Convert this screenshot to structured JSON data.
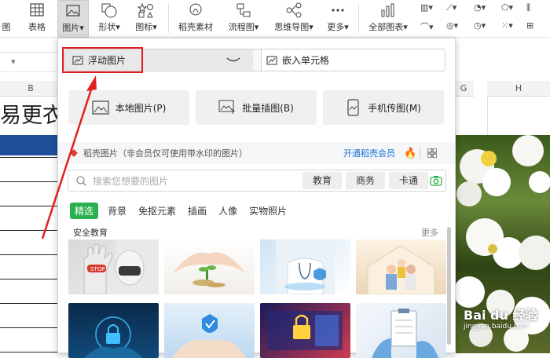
{
  "ribbon": {
    "items": [
      {
        "label": "图"
      },
      {
        "label": "表格"
      },
      {
        "label": "图片▾"
      },
      {
        "label": "形状▾"
      },
      {
        "label": "图标▾"
      },
      {
        "label": "稻壳素材"
      },
      {
        "label": "流程图▾"
      },
      {
        "label": "思维导图▾"
      },
      {
        "label": "更多▾"
      },
      {
        "label": "全部图表▾"
      }
    ]
  },
  "sheet": {
    "col_b": "B",
    "col_g": "G",
    "col_h": "H",
    "title_text": "易更衣室"
  },
  "panel": {
    "float_label": "浮动图片",
    "embed_label": "嵌入单元格",
    "local_btn": "本地图片(P)",
    "batch_btn": "批量插图(B)",
    "phone_btn": "手机传图(M)",
    "section_title": "稻壳图片（非会员仅可使用带水印的图片）",
    "member_link": "开通稻壳会员",
    "search_placeholder": "搜索您想要的图片",
    "chips": [
      "教育",
      "商务",
      "卡通"
    ],
    "tabs": [
      {
        "label": "精选",
        "selected": true
      },
      {
        "label": "背景"
      },
      {
        "label": "免抠元素"
      },
      {
        "label": "插画"
      },
      {
        "label": "人像"
      },
      {
        "label": "实物照片"
      }
    ],
    "category_title": "安全教育",
    "more_link": "更多",
    "stop_text": "STOP"
  },
  "watermark": {
    "brand": "Bai du 经验",
    "url": "jingyan.baidu.com"
  },
  "colors": {
    "accent_green": "#2bb04f",
    "highlight_red": "#e02020",
    "member_blue": "#1a6fd8",
    "header_blue": "#1e4f9a"
  }
}
